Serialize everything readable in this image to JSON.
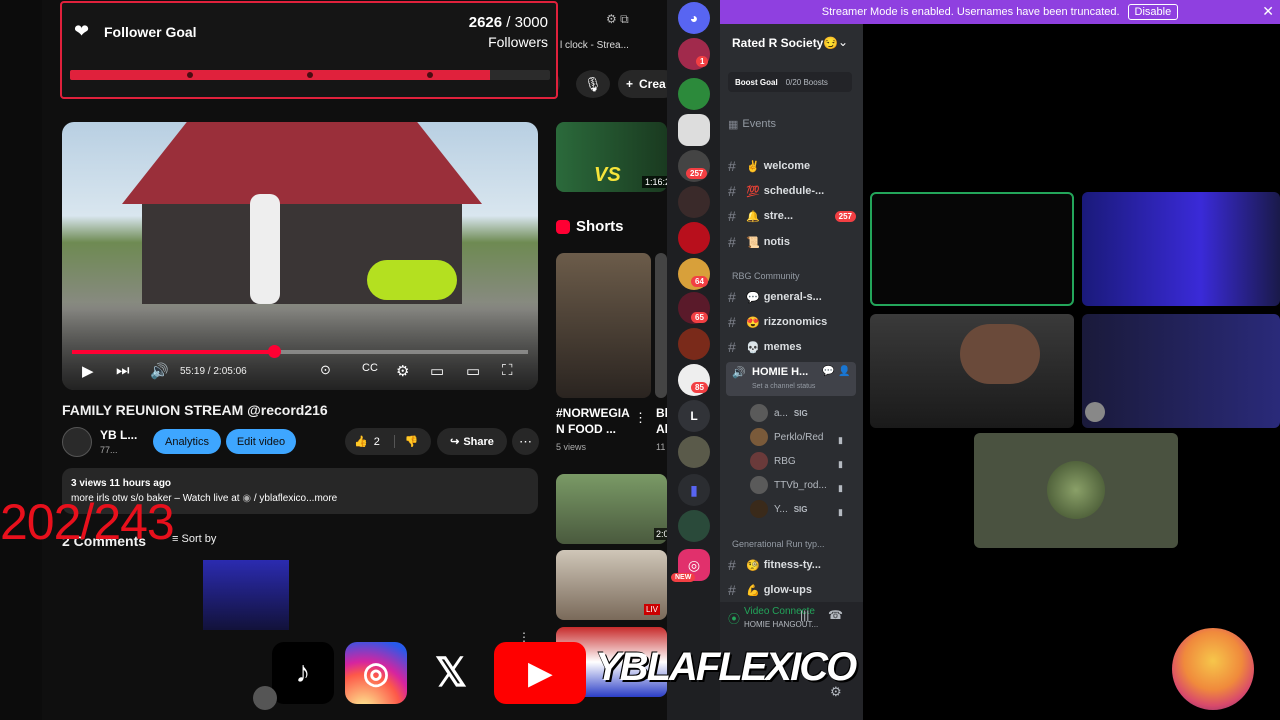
{
  "follower_goal": {
    "title": "Follower Goal",
    "current": "2626",
    "separator": "/",
    "target": "3000",
    "unit": "Followers",
    "progress": 0.8753,
    "color": "#e0213c"
  },
  "counter_overlay": "202/243",
  "youtube": {
    "tab_title": "l clock - Strea...",
    "create_label": "Crea",
    "player": {
      "time": "55:19 / 2:05:06",
      "progress": 0.442
    },
    "video_title": "FAMILY REUNION STREAM @record216",
    "channel": {
      "name": "YB L...",
      "subs": "77..."
    },
    "analytics_label": "Analytics",
    "edit_label": "Edit video",
    "like_count": "2",
    "share_label": "Share",
    "description": {
      "stats": "3 views  11 hours ago",
      "text": "more irls otw s/o baker  – Watch live at",
      "link": "/ yblaflexico",
      "more": "...more"
    },
    "comments_title": "2 Comments",
    "sort_label": "Sort by",
    "thumb_vs_time": "1:16:2",
    "thumb_vs_label": "VS",
    "shorts_title": "Shorts",
    "short1": {
      "title": "#NORWEGIA N FOOD ...",
      "views": "5 views"
    },
    "short2_title": "Bl Al",
    "short2_views": "11",
    "live_badge": "LIV",
    "time_label": "2:0"
  },
  "discord": {
    "banner": "Streamer Mode is enabled. Usernames have been truncated.",
    "disable_label": "Disable",
    "server_name": "Rated R Society😏",
    "boost": {
      "label": "Boost Goal",
      "value": "0/20 Boosts"
    },
    "events_label": "Events",
    "channels_top": [
      {
        "emoji": "✌️",
        "name": "welcome"
      },
      {
        "emoji": "💯",
        "name": "schedule-..."
      },
      {
        "emoji": "🔔",
        "name": "stre...",
        "badge": "257"
      },
      {
        "emoji": "📜",
        "name": "notis"
      }
    ],
    "category_rbg": "RBG Community",
    "channels_rbg": [
      {
        "emoji": "💬",
        "name": "general-s..."
      },
      {
        "emoji": "😍",
        "name": "rizzonomics"
      },
      {
        "emoji": "💀",
        "name": "memes"
      }
    ],
    "voice_channel": "HOMIE H...",
    "voice_status": "Set a channel status",
    "voice_users": [
      {
        "name": "a...",
        "tag": "SIG"
      },
      {
        "name": "Perklo/Red",
        "tag": ""
      },
      {
        "name": "RBG",
        "tag": ""
      },
      {
        "name": "TTVb_rod...",
        "tag": ""
      },
      {
        "name": "Y...",
        "tag": "SIG"
      }
    ],
    "category_gen": "Generational Run typ...",
    "channels_gen": [
      {
        "emoji": "🧐",
        "name": "fitness-ty..."
      },
      {
        "emoji": "💪",
        "name": "glow-ups"
      }
    ],
    "server_badges": [
      "1",
      "257",
      "64",
      "65",
      "85"
    ],
    "new_label": "NEW",
    "letter_server": "L",
    "vc_connected": "Video Connecte",
    "vc_channel": "HOMIE HANGOUT..."
  },
  "socials": {
    "brand": "YBLAFLEXICO"
  }
}
